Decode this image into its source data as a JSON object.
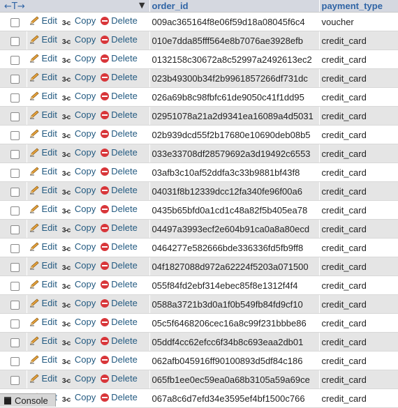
{
  "header": {
    "nav_arrows": "←T→",
    "sort_indicator": "▼",
    "columns": [
      "order_id",
      "payment_type"
    ]
  },
  "actions": {
    "edit": "Edit",
    "copy": "Copy",
    "delete": "Delete"
  },
  "copy_icon_glyph": "3-c",
  "rows": [
    {
      "order_id": "009ac365164f8e06f59d18a08045f6c4",
      "payment_type": "voucher"
    },
    {
      "order_id": "010e7dda85fff564e8b7076ae3928efb",
      "payment_type": "credit_card"
    },
    {
      "order_id": "0132158c30672a8c52997a2492613ec2",
      "payment_type": "credit_card"
    },
    {
      "order_id": "023b49300b34f2b9961857266df731dc",
      "payment_type": "credit_card"
    },
    {
      "order_id": "026a69b8c98fbfc61de9050c41f1dd95",
      "payment_type": "credit_card"
    },
    {
      "order_id": "02951078a21a2d9341ea16089a4d5031",
      "payment_type": "credit_card"
    },
    {
      "order_id": "02b939dcd55f2b17680e10690deb08b5",
      "payment_type": "credit_card"
    },
    {
      "order_id": "033e33708df28579692a3d19492c6553",
      "payment_type": "credit_card"
    },
    {
      "order_id": "03afb3c10af52ddfa3c33b9881bf43f8",
      "payment_type": "credit_card"
    },
    {
      "order_id": "04031f8b12339dcc12fa340fe96f00a6",
      "payment_type": "credit_card"
    },
    {
      "order_id": "0435b65bfd0a1cd1c48a82f5b405ea78",
      "payment_type": "credit_card"
    },
    {
      "order_id": "04497a3993ecf2e604b91ca0a8a80ecd",
      "payment_type": "credit_card"
    },
    {
      "order_id": "0464277e582666bde336336fd5fb9ff8",
      "payment_type": "credit_card"
    },
    {
      "order_id": "04f1827088d972a62224f5203a071500",
      "payment_type": "credit_card"
    },
    {
      "order_id": "055f84fd2ebf314ebec85f8e1312f4f4",
      "payment_type": "credit_card"
    },
    {
      "order_id": "0588a3721b3d0a1f0b549fb84fd9cf10",
      "payment_type": "credit_card"
    },
    {
      "order_id": "05c5f6468206cec16a8c99f231bbbe86",
      "payment_type": "credit_card"
    },
    {
      "order_id": "05ddf4cc62efcc6f34b8c693eaa2db01",
      "payment_type": "credit_card"
    },
    {
      "order_id": "062afb045916ff90100893d5df84c186",
      "payment_type": "credit_card"
    },
    {
      "order_id": "065fb1ee0ec59ea0a68b3105a59a69ce",
      "payment_type": "credit_card"
    },
    {
      "order_id": "067a8c6d7efd34e3595ef4bf1500c766",
      "payment_type": "credit_card"
    }
  ],
  "console": {
    "label": "Console"
  }
}
